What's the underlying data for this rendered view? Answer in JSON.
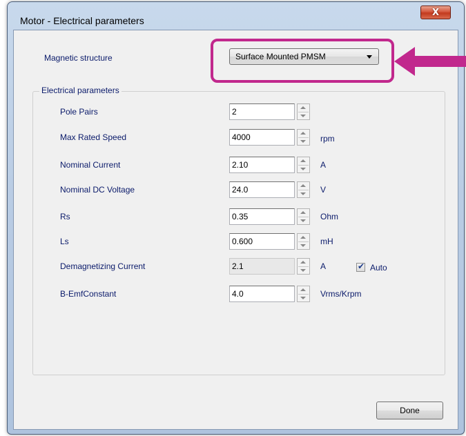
{
  "window": {
    "title": "Motor - Electrical parameters",
    "close_glyph": "X"
  },
  "magnetic_structure": {
    "label": "Magnetic structure",
    "selected": "Surface Mounted PMSM",
    "highlight_color": "#c1288d"
  },
  "electrical": {
    "group_title": "Electrical parameters",
    "rows": [
      {
        "label": "Pole Pairs",
        "value": "2",
        "unit": ""
      },
      {
        "label": "Max Rated Speed",
        "value": "4000",
        "unit": "rpm"
      },
      {
        "label": "Nominal Current",
        "value": "2.10",
        "unit": "A"
      },
      {
        "label": "Nominal DC Voltage",
        "value": "24.0",
        "unit": "V"
      },
      {
        "label": "Rs",
        "value": "0.35",
        "unit": "Ohm"
      },
      {
        "label": "Ls",
        "value": "0.600",
        "unit": "mH"
      },
      {
        "label": "Demagnetizing Current",
        "value": "2.1",
        "unit": "A",
        "disabled": true
      },
      {
        "label": "B-EmfConstant",
        "value": "4.0",
        "unit": "Vrms/Krpm"
      }
    ],
    "auto": {
      "label": "Auto",
      "checked": true
    }
  },
  "footer": {
    "done_label": "Done"
  }
}
